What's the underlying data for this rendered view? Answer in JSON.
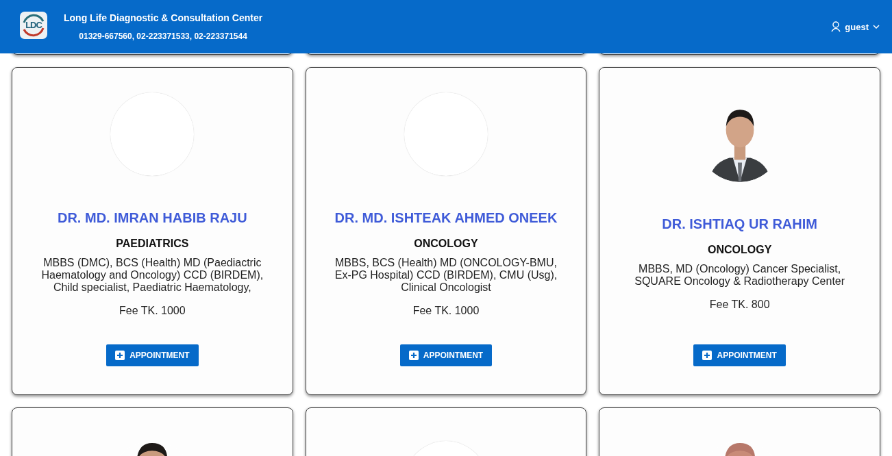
{
  "header": {
    "logo_text": "LDC",
    "title": "Long Life Diagnostic & Consultation Center",
    "phones": "01329-667560, 02-223371533, 02-223371544",
    "user": "guest"
  },
  "cards_above": [
    {
      "kind": "card"
    },
    {
      "kind": "card"
    },
    {
      "kind": "card"
    }
  ],
  "doctors": [
    {
      "photo": {
        "kind": "blank"
      },
      "name": "DR. MD. IMRAN HABIB RAJU",
      "department": "PAEDIATRICS",
      "qualifications": "MBBS (DMC), BCS (Health) MD (Paediactric Haematology and Oncology) CCD (BIRDEM), Child specialist, Paediatric Haematology,",
      "fee": "Fee TK. 1000",
      "button": "APPOINTMENT"
    },
    {
      "photo": {
        "kind": "blank"
      },
      "name": "DR. MD. ISHTEAK AHMED ONEEK",
      "department": "ONCOLOGY",
      "qualifications": "MBBS, BCS (Health) MD (ONCOLOGY-BMU, Ex-PG Hospital) CCD (BIRDEM), CMU (Usg), Clinical Oncologist",
      "fee": "Fee TK. 1000",
      "button": "APPOINTMENT"
    },
    {
      "photo": {
        "kind": "picture"
      },
      "name": "DR. ISHTIAQ UR RAHIM",
      "department": "ONCOLOGY",
      "qualifications": "MBBS, MD (Oncology) Cancer Specialist, SQUARE Oncology & Radiotherapy Center",
      "fee": "Fee TK. 800",
      "button": "APPOINTMENT"
    }
  ],
  "cards_below": [
    {
      "photo": {
        "kind": "picture"
      }
    },
    {
      "photo": {
        "kind": "blank"
      }
    },
    {
      "photo": {
        "kind": "picture"
      }
    }
  ]
}
